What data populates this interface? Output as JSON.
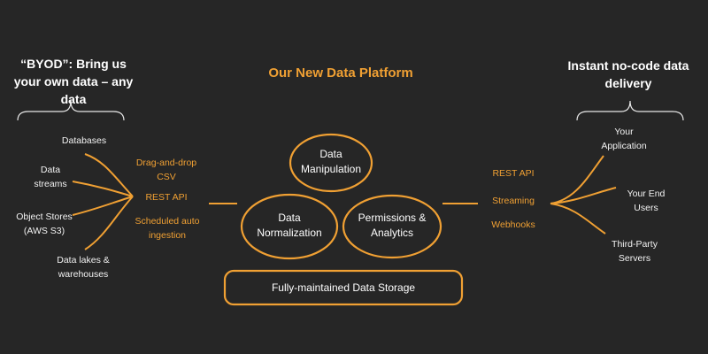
{
  "title": "Our New Data Platform",
  "left_header": "“BYOD”: Bring us your own data – any data",
  "left_sources": [
    "Databases",
    "Data streams",
    "Object Stores (AWS S3)",
    "Data lakes & warehouses"
  ],
  "ingestion_methods": [
    "Drag-and-drop CSV",
    "REST API",
    "Scheduled auto ingestion"
  ],
  "core_nodes": {
    "manipulation": "Data Manipulation",
    "normalization": "Data Normalization",
    "permissions": "Permissions & Analytics"
  },
  "storage": "Fully-maintained Data Storage",
  "delivery_methods": [
    "REST API",
    "Streaming",
    "Webhooks"
  ],
  "right_header": "Instant no-code data delivery",
  "right_destinations": [
    "Your Application",
    "Your End Users",
    "Third-Party Servers"
  ],
  "colors": {
    "background": "#262626",
    "accent": "#f0a033",
    "text": "#ffffff"
  }
}
